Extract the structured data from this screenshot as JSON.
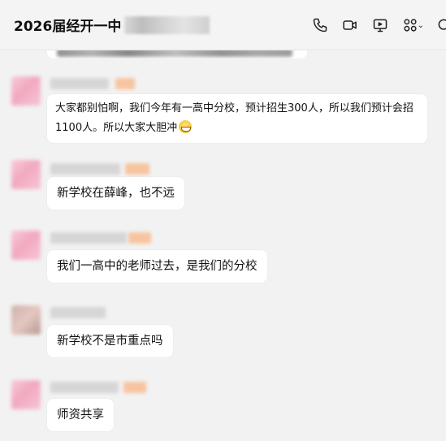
{
  "header": {
    "title": "2026届经开一中",
    "icons": [
      "phone-icon",
      "video-call-icon",
      "screen-share-icon",
      "apps-icon",
      "chevron-down-icon",
      "search-icon"
    ]
  },
  "messages": [
    {
      "text": "大家都别怕啊，我们今年有一高中分校，预计招生300人，所以我们预计会招1100人。所以大家大胆冲",
      "emoji": "grinning-emoji"
    },
    {
      "text": "新学校在薛峰，也不远"
    },
    {
      "text": "我们一高中的老师过去，是我们的分校"
    },
    {
      "text": "新学校不是市重点吗"
    },
    {
      "text": "师资共享"
    }
  ],
  "colors": {
    "background": "#f2f2f2",
    "bubble": "#ffffff",
    "avatar_pink": "#f2a9c0"
  }
}
